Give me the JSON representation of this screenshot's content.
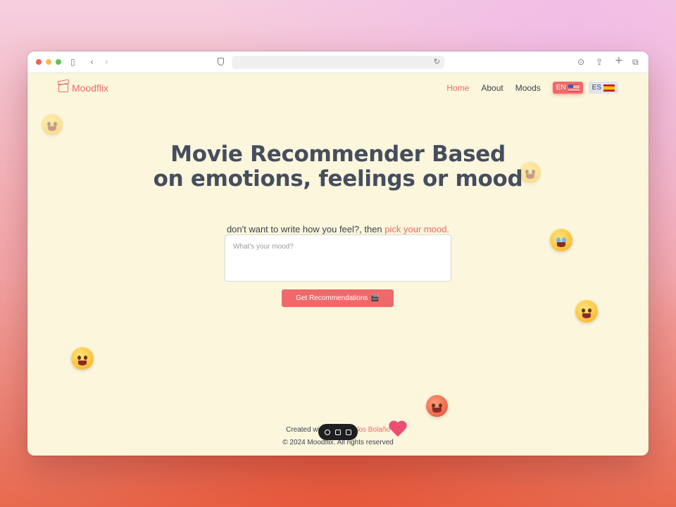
{
  "browser": {
    "address": ""
  },
  "site": {
    "brand": "Moodflix",
    "nav": {
      "home": "Home",
      "about": "About",
      "moods": "Moods"
    },
    "languages": {
      "en": "EN",
      "es": "ES"
    }
  },
  "hero": {
    "title_line1": "Movie Recommender Based",
    "title_line2": "on emotions, feelings or mood",
    "subtitle_prefix": "don't want to write how you feel?, then ",
    "subtitle_link": "pick your mood."
  },
  "form": {
    "mood_placeholder": "What's your mood?",
    "mood_value": "",
    "submit_label": "Get Recommendations",
    "submit_emoji": "🎬"
  },
  "footer": {
    "created_prefix": "Created wi",
    "created_author": "rlos Bolaño",
    "copyright": "© 2024 Moodflix. All rights reserved"
  },
  "colors": {
    "accent": "#f0696a",
    "background": "#fbf6dc",
    "heading": "#454e5e"
  }
}
